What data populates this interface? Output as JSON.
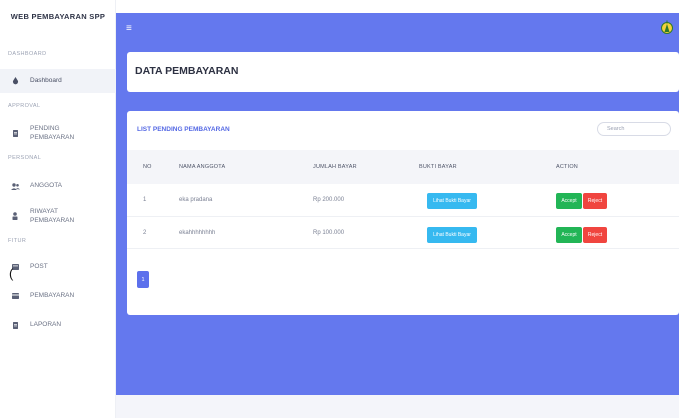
{
  "sidebar": {
    "brand": "WEB PEMBAYARAN SPP",
    "sections": {
      "dashboard": "DASHBOARD",
      "approval": "APPROVAL",
      "personal": "PERSONAL",
      "fitur": "FITUR"
    },
    "items": [
      {
        "label": "Dashboard",
        "icon": "dashboard-icon"
      },
      {
        "label": "PENDING\nPEMBAYARAN",
        "icon": "document-icon"
      },
      {
        "label": "ANGGOTA",
        "icon": "users-icon"
      },
      {
        "label": "RIWAYAT\nPEMBAYARAN",
        "icon": "user-history-icon"
      },
      {
        "label": "POST",
        "icon": "post-icon"
      },
      {
        "label": "PEMBAYARAN",
        "icon": "payment-icon"
      },
      {
        "label": "LAPORAN",
        "icon": "report-icon"
      }
    ]
  },
  "topbar": {
    "menu_icon": "≡",
    "avatar_icon": "user-avatar-icon"
  },
  "page": {
    "title": "DATA PEMBAYARAN"
  },
  "card": {
    "title": "LIST PENDING PEMBAYARAN",
    "search_placeholder": "Search",
    "columns": [
      "NO",
      "NAMA ANGGOTA",
      "JUMLAH BAYAR",
      "BUKTI BAYAR",
      "ACTION"
    ],
    "rows": [
      {
        "no": "1",
        "nama": "eka pradana",
        "jumlah": "Rp 200.000",
        "bukti": "Lihat Bukti Bayar",
        "accept": "Accept",
        "reject": "Reject"
      },
      {
        "no": "2",
        "nama": "ekahhhhhhhh",
        "jumlah": "Rp 100.000",
        "bukti": "Lihat Bukti Bayar",
        "accept": "Accept",
        "reject": "Reject"
      }
    ],
    "pagination": {
      "current": "1"
    }
  },
  "misc": {
    "stray_char": "("
  },
  "colors": {
    "primary": "#6478ee",
    "accept": "#22b556",
    "reject": "#f0453f",
    "info": "#36b9f0"
  }
}
